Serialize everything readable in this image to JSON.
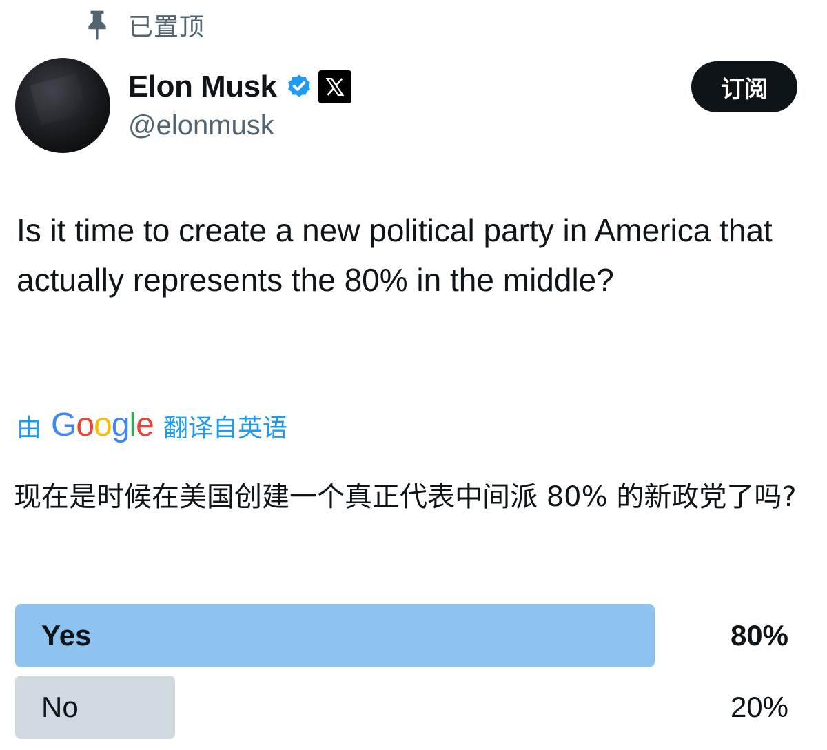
{
  "pinned": {
    "label": "已置顶",
    "icon": "pin-icon"
  },
  "author": {
    "display_name": "Elon Musk",
    "handle": "@elonmusk",
    "verified_icon": "verified-badge-icon",
    "affiliate_icon": "x-logo-icon"
  },
  "subscribe_label": "订阅",
  "tweet": {
    "text": "Is it time to create a new political party in America that actually represents the 80% in the middle?"
  },
  "translation": {
    "prefix": "由",
    "brand": "Google",
    "suffix": "翻译自英语",
    "text": "现在是时候在美国创建一个真正代表中间派 80% 的新政党了吗?"
  },
  "poll": {
    "options": [
      {
        "label": "Yes",
        "percent_text": "80%",
        "percent": 80,
        "winner": true
      },
      {
        "label": "No",
        "percent_text": "20%",
        "percent": 20,
        "winner": false
      }
    ]
  },
  "colors": {
    "link": "#1d9bf0",
    "winner_bar": "#8ec3f0",
    "other_bar": "#cfd9de",
    "secondary_text": "#536471",
    "verified": "#1d9bf0"
  }
}
